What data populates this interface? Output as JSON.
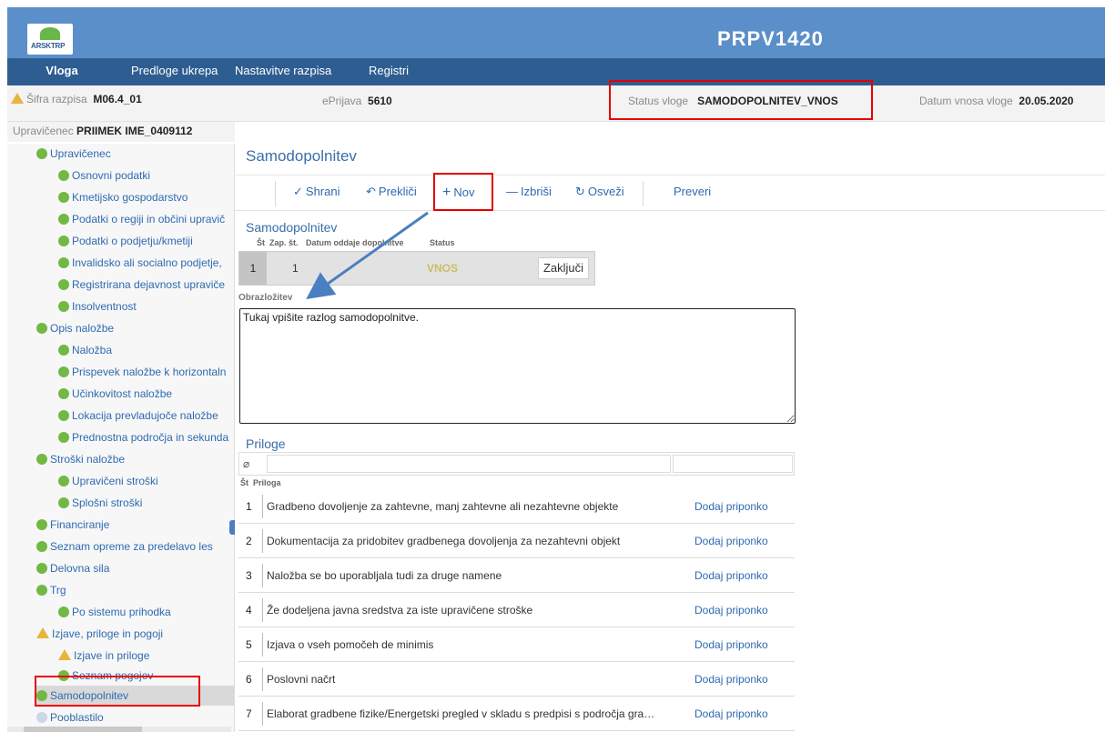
{
  "app": {
    "logo_text": "ARSKTRP",
    "title": "PRPV1420"
  },
  "menu": {
    "items": [
      {
        "label": "Vloga"
      },
      {
        "label": "Predloge ukrepa"
      },
      {
        "label": "Nastavitve razpisa"
      },
      {
        "label": "Registri"
      }
    ]
  },
  "info": {
    "sifra_label": "Šifra razpisa",
    "sifra_value": "M06.4_01",
    "eprijava_label": "ePrijava",
    "eprijava_value": "5610",
    "status_label": "Status vloge",
    "status_value": "SAMODOPOLNITEV_VNOS",
    "datum_label": "Datum vnosa vloge",
    "datum_value": "20.05.2020",
    "upravicenec_label": "Upravičenec",
    "upravicenec_value": "PRIIMEK IME_0409112"
  },
  "sidebar": {
    "items": [
      {
        "label": "Upravičenec",
        "icon": "green-dot-icon"
      },
      {
        "label": "Osnovni podatki",
        "icon": "green-dot-icon"
      },
      {
        "label": "Kmetijsko gospodarstvo",
        "icon": "green-dot-icon"
      },
      {
        "label": "Podatki o regiji in občini upravič",
        "icon": "green-dot-icon"
      },
      {
        "label": "Podatki o podjetju/kmetiji",
        "icon": "green-dot-icon"
      },
      {
        "label": "Invalidsko ali socialno podjetje,",
        "icon": "green-dot-icon"
      },
      {
        "label": "Registrirana dejavnost upraviče",
        "icon": "green-dot-icon"
      },
      {
        "label": "Insolventnost",
        "icon": "green-dot-icon"
      },
      {
        "label": "Opis naložbe",
        "icon": "green-dot-icon"
      },
      {
        "label": "Naložba",
        "icon": "green-dot-icon"
      },
      {
        "label": "Prispevek naložbe k horizontaln",
        "icon": "green-dot-icon"
      },
      {
        "label": "Učinkovitost naložbe",
        "icon": "green-dot-icon"
      },
      {
        "label": "Lokacija prevladujoče naložbe",
        "icon": "green-dot-icon"
      },
      {
        "label": "Prednostna področja in sekunda",
        "icon": "green-dot-icon"
      },
      {
        "label": "Stroški naložbe",
        "icon": "green-dot-icon"
      },
      {
        "label": "Upravičeni stroški",
        "icon": "green-dot-icon"
      },
      {
        "label": "Splošni stroški",
        "icon": "green-dot-icon"
      },
      {
        "label": "Financiranje",
        "icon": "green-dot-icon"
      },
      {
        "label": "Seznam opreme za predelavo les",
        "icon": "green-dot-icon"
      },
      {
        "label": "Delovna sila",
        "icon": "green-dot-icon"
      },
      {
        "label": "Trg",
        "icon": "green-dot-icon"
      },
      {
        "label": "Po sistemu prihodka",
        "icon": "green-dot-icon"
      },
      {
        "label": "Izjave, priloge in pogoji",
        "icon": "warning-triangle-icon"
      },
      {
        "label": "Izjave in priloge",
        "icon": "warning-triangle-icon"
      },
      {
        "label": "Seznam pogojev",
        "icon": "green-dot-icon"
      },
      {
        "label": "Samodopolnitev",
        "icon": "green-dot-icon"
      },
      {
        "label": "Pooblastilo",
        "icon": "grey-dot-icon"
      }
    ]
  },
  "main": {
    "title": "Samodopolnitev",
    "toolbar": {
      "save": "Shrani",
      "cancel": "Prekliči",
      "new": "Nov",
      "delete": "Izbriši",
      "refresh": "Osveži",
      "check": "Preveri"
    },
    "grid": {
      "title": "Samodopolnitev",
      "headers": [
        "Št",
        "Zap. št.",
        "Datum oddaje dopolnitve",
        "Status"
      ],
      "row": {
        "st": "1",
        "zap": "1",
        "status": "VNOS",
        "action": "Zaključi"
      }
    },
    "obrazlozitev": {
      "label": "Obrazložitev",
      "value": "Tukaj vpišite razlog samodopolnitve."
    },
    "priloge": {
      "title": "Priloge",
      "headers": [
        "Št",
        "Priloga"
      ],
      "action_label": "Dodaj priponko",
      "rows": [
        {
          "n": "1",
          "text": "Gradbeno dovoljenje za zahtevne, manj zahtevne ali nezahtevne objekte"
        },
        {
          "n": "2",
          "text": "Dokumentacija za pridobitev gradbenega dovoljenja za nezahtevni objekt"
        },
        {
          "n": "3",
          "text": "Naložba se bo uporabljala tudi za druge namene"
        },
        {
          "n": "4",
          "text": "Že dodeljena javna sredstva za iste upravičene stroške"
        },
        {
          "n": "5",
          "text": "Izjava o vseh pomočeh de minimis"
        },
        {
          "n": "6",
          "text": "Poslovni načrt"
        },
        {
          "n": "7",
          "text": "Elaborat gradbene fizike/Energetski pregled v skladu s predpisi s področja gra…"
        }
      ]
    }
  },
  "colors": {
    "header": "#5b8fc9",
    "menubar": "#2e5d91",
    "highlight": "#e60000",
    "link": "#2e6ab0",
    "status_vnos": "#c8c060",
    "arrow": "#4a7fc1"
  }
}
